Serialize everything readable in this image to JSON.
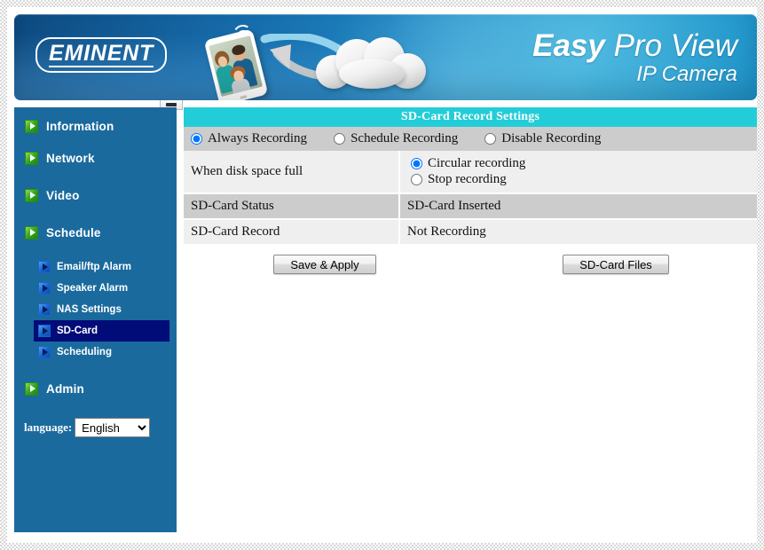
{
  "banner": {
    "logo": "EMINENT",
    "product_line1_bold": "Easy",
    "product_line1_rest": " Pro View",
    "product_line2": "IP Camera",
    "icons": [
      "smartphone-photo-icon",
      "wifi-signal-icon",
      "cloud-icon",
      "sync-arrows-icon"
    ],
    "colors": {
      "bg_start": "#0d4a80",
      "bg_end": "#22a3d4"
    }
  },
  "sidebar": {
    "bg_color": "#1a6a9e",
    "active_color": "#020c78",
    "main_items": [
      {
        "label": "Information",
        "icon": "green-arrow-icon"
      },
      {
        "label": "Network",
        "icon": "green-arrow-icon"
      },
      {
        "label": "Video",
        "icon": "green-arrow-icon"
      },
      {
        "label": "Schedule",
        "icon": "green-arrow-icon"
      },
      {
        "label": "Admin",
        "icon": "green-arrow-icon"
      }
    ],
    "sub_items": [
      {
        "label": "Email/ftp Alarm",
        "icon": "blue-arrow-icon",
        "active": false
      },
      {
        "label": "Speaker Alarm",
        "icon": "blue-arrow-icon",
        "active": false
      },
      {
        "label": "NAS Settings",
        "icon": "blue-arrow-icon",
        "active": false
      },
      {
        "label": "SD-Card",
        "icon": "blue-arrow-icon",
        "active": true
      },
      {
        "label": "Scheduling",
        "icon": "blue-arrow-icon",
        "active": false
      }
    ],
    "language_label": "language:",
    "language_value": "English",
    "language_options": [
      "English"
    ]
  },
  "content": {
    "panel_title": "SD-Card Record Settings",
    "panel_title_bg": "#22cdd8",
    "record_modes": [
      {
        "label": "Always Recording",
        "checked": true
      },
      {
        "label": "Schedule Recording",
        "checked": false
      },
      {
        "label": "Disable Recording",
        "checked": false
      }
    ],
    "rows": [
      {
        "key": "When disk space full",
        "type": "radios",
        "options": [
          {
            "label": "Circular recording",
            "checked": true
          },
          {
            "label": "Stop recording",
            "checked": false
          }
        ]
      },
      {
        "key": "SD-Card Status",
        "type": "text",
        "value": "SD-Card Inserted"
      },
      {
        "key": "SD-Card Record",
        "type": "text",
        "value": "Not Recording"
      }
    ],
    "buttons": {
      "save": "Save & Apply",
      "files": "SD-Card Files"
    }
  }
}
